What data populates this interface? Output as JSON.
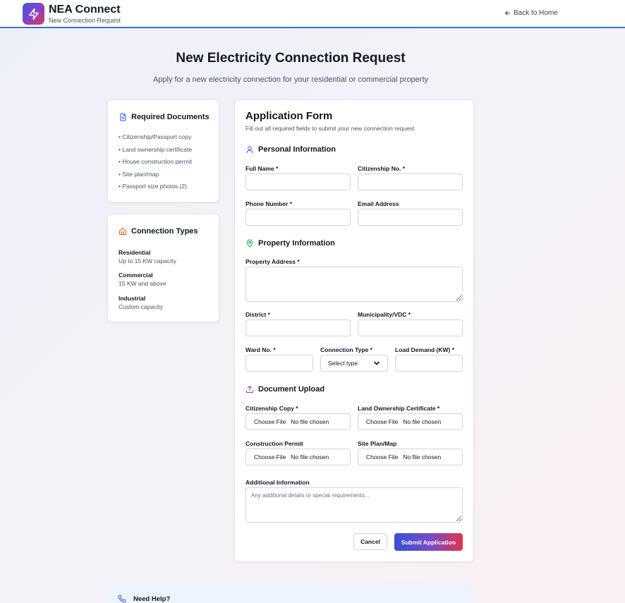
{
  "header": {
    "brand_title": "NEA Connect",
    "brand_subtitle": "New Connection Request",
    "back_link": "Back to Home"
  },
  "page": {
    "title": "New Electricity Connection Request",
    "subtitle": "Apply for a new electricity connection for your residential or commercial property"
  },
  "required_documents": {
    "title": "Required Documents",
    "items": [
      "• Citizenship/Passport copy",
      "• Land ownership certificate",
      "• House construction permit",
      "• Site plan/map",
      "• Passport size photos (2)"
    ]
  },
  "connection_types": {
    "title": "Connection Types",
    "items": [
      {
        "name": "Residential",
        "desc": "Up to 15 KW capacity"
      },
      {
        "name": "Commercial",
        "desc": "15 KW and above"
      },
      {
        "name": "Industrial",
        "desc": "Custom capacity"
      }
    ]
  },
  "form": {
    "title": "Application Form",
    "subtitle": "Fill out all required fields to submit your new connection request",
    "personal": {
      "heading": "Personal Information",
      "full_name": "Full Name *",
      "citizenship_no": "Citizenship No. *",
      "phone": "Phone Number *",
      "email": "Email Address"
    },
    "property": {
      "heading": "Property Information",
      "address": "Property Address *",
      "district": "District *",
      "municipality": "Municipality/VDC *",
      "ward": "Ward No. *",
      "connection_type": "Connection Type *",
      "connection_type_value": "Select type",
      "load_demand": "Load Demand (KW) *"
    },
    "upload": {
      "heading": "Document Upload",
      "choose_label": "Choose File",
      "no_file": "No file chosen",
      "citizenship_copy": "Citizenship Copy *",
      "land_ownership": "Land Ownership Certificate *",
      "construction_permit": "Construction Permit",
      "site_plan": "Site Plan/Map"
    },
    "additional": {
      "label": "Additional Information",
      "placeholder": "Any additional details or special requirements..."
    },
    "cancel": "Cancel",
    "submit": "Submit Application"
  },
  "help": {
    "title": "Need Help?"
  },
  "colors": {
    "accent_blue": "#3b5bdb",
    "accent_red": "#e53950",
    "accent_purple": "#8b3fc8",
    "orange_icon": "#ea580c",
    "green_icon": "#16a34a"
  }
}
